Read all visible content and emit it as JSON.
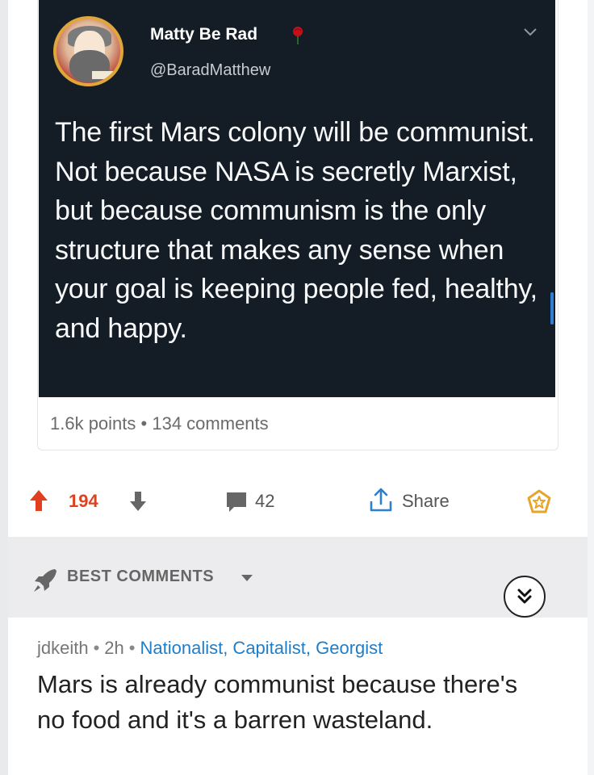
{
  "tweet": {
    "display_name": "Matty Be Rad",
    "handle": "@BaradMatthew",
    "text": "The first Mars colony will be communist. Not because NASA is secretly Marxist, but because communism is the only structure that makes any sense when your goal is keeping people fed, healthy, and happy."
  },
  "post_stats": {
    "points": "1.6k points",
    "separator": "•",
    "comments": "134 comments"
  },
  "actions": {
    "upvotes": "194",
    "comments": "42",
    "share_label": "Share"
  },
  "best_comments": {
    "label": "BEST COMMENTS"
  },
  "comment": {
    "author": "jdkeith",
    "age": "2h",
    "separator": "•",
    "flair": "Nationalist, Capitalist, Georgist",
    "body": "Mars is already communist because there's no food and it's a barren wasteland."
  },
  "colors": {
    "tweet_background": "#141d26",
    "upvote": "#e1401e",
    "flair": "#1f7ec9",
    "bar_background": "#ececee"
  }
}
